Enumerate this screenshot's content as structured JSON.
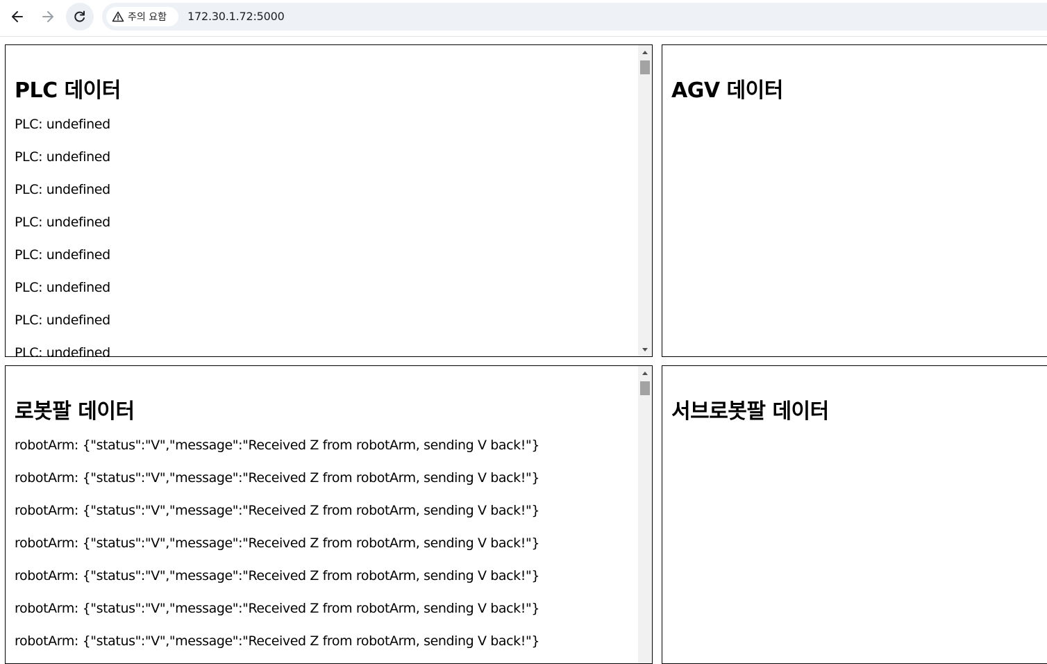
{
  "browser": {
    "security_label": "주의 요함",
    "url": "172.30.1.72:5000"
  },
  "panels": {
    "plc": {
      "title": "PLC 데이터",
      "entries": [
        "PLC: undefined",
        "PLC: undefined",
        "PLC: undefined",
        "PLC: undefined",
        "PLC: undefined",
        "PLC: undefined",
        "PLC: undefined",
        "PLC: undefined"
      ]
    },
    "agv": {
      "title": "AGV 데이터",
      "entries": []
    },
    "robot_arm": {
      "title": "로봇팔 데이터",
      "entries": [
        "robotArm: {\"status\":\"V\",\"message\":\"Received Z from robotArm, sending V back!\"}",
        "robotArm: {\"status\":\"V\",\"message\":\"Received Z from robotArm, sending V back!\"}",
        "robotArm: {\"status\":\"V\",\"message\":\"Received Z from robotArm, sending V back!\"}",
        "robotArm: {\"status\":\"V\",\"message\":\"Received Z from robotArm, sending V back!\"}",
        "robotArm: {\"status\":\"V\",\"message\":\"Received Z from robotArm, sending V back!\"}",
        "robotArm: {\"status\":\"V\",\"message\":\"Received Z from robotArm, sending V back!\"}",
        "robotArm: {\"status\":\"V\",\"message\":\"Received Z from robotArm, sending V back!\"}"
      ]
    },
    "sub_robot_arm": {
      "title": "서브로봇팔 데이터",
      "entries": []
    }
  }
}
